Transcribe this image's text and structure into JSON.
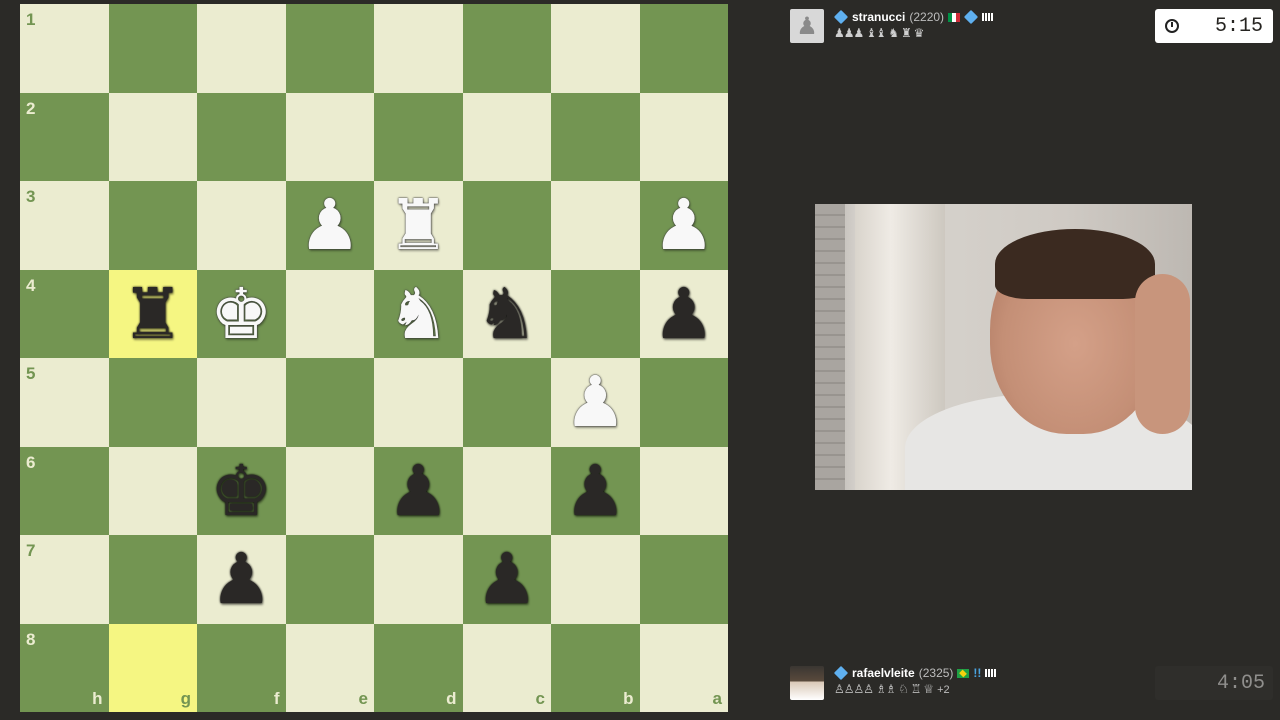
{
  "board": {
    "ranks": [
      "1",
      "2",
      "3",
      "4",
      "5",
      "6",
      "7",
      "8"
    ],
    "files": [
      "h",
      "g",
      "f",
      "e",
      "d",
      "c",
      "b",
      "a"
    ],
    "highlight": [
      "g4",
      "g8"
    ],
    "pieces": [
      {
        "sq": "e3",
        "color": "white",
        "type": "pawn",
        "glyph": "♟"
      },
      {
        "sq": "d3",
        "color": "white",
        "type": "rook",
        "glyph": "♜"
      },
      {
        "sq": "a3",
        "color": "white",
        "type": "pawn",
        "glyph": "♟"
      },
      {
        "sq": "g4",
        "color": "black",
        "type": "rook",
        "glyph": "♜"
      },
      {
        "sq": "f4",
        "color": "white",
        "type": "king",
        "glyph": "♚"
      },
      {
        "sq": "d4",
        "color": "white",
        "type": "knight",
        "glyph": "♞"
      },
      {
        "sq": "c4",
        "color": "black",
        "type": "knight",
        "glyph": "♞"
      },
      {
        "sq": "a4",
        "color": "black",
        "type": "pawn",
        "glyph": "♟"
      },
      {
        "sq": "b5",
        "color": "white",
        "type": "pawn",
        "glyph": "♟"
      },
      {
        "sq": "f6",
        "color": "black",
        "type": "king",
        "glyph": "♚"
      },
      {
        "sq": "d6",
        "color": "black",
        "type": "pawn",
        "glyph": "♟"
      },
      {
        "sq": "b6",
        "color": "black",
        "type": "pawn",
        "glyph": "♟"
      },
      {
        "sq": "f7",
        "color": "black",
        "type": "pawn",
        "glyph": "♟"
      },
      {
        "sq": "c7",
        "color": "black",
        "type": "pawn",
        "glyph": "♟"
      }
    ],
    "colors": {
      "light": "#ebecd0",
      "dark": "#739552",
      "hl_light": "#f5f682",
      "hl_dark": "#b9ca43"
    }
  },
  "top_player": {
    "name": "stranucci",
    "rating": "(2220)",
    "captured": "♟♟♟ ♝♝ ♞ ♜ ♛",
    "clock": "5:15",
    "avatar_glyph": "♟"
  },
  "bottom_player": {
    "name": "rafaelvleite",
    "rating": "(2325)",
    "excl": "!!",
    "captured": "♙♙♙♙ ♗♗ ♘ ♖ ♕",
    "advantage": "+2",
    "clock": "4:05"
  }
}
